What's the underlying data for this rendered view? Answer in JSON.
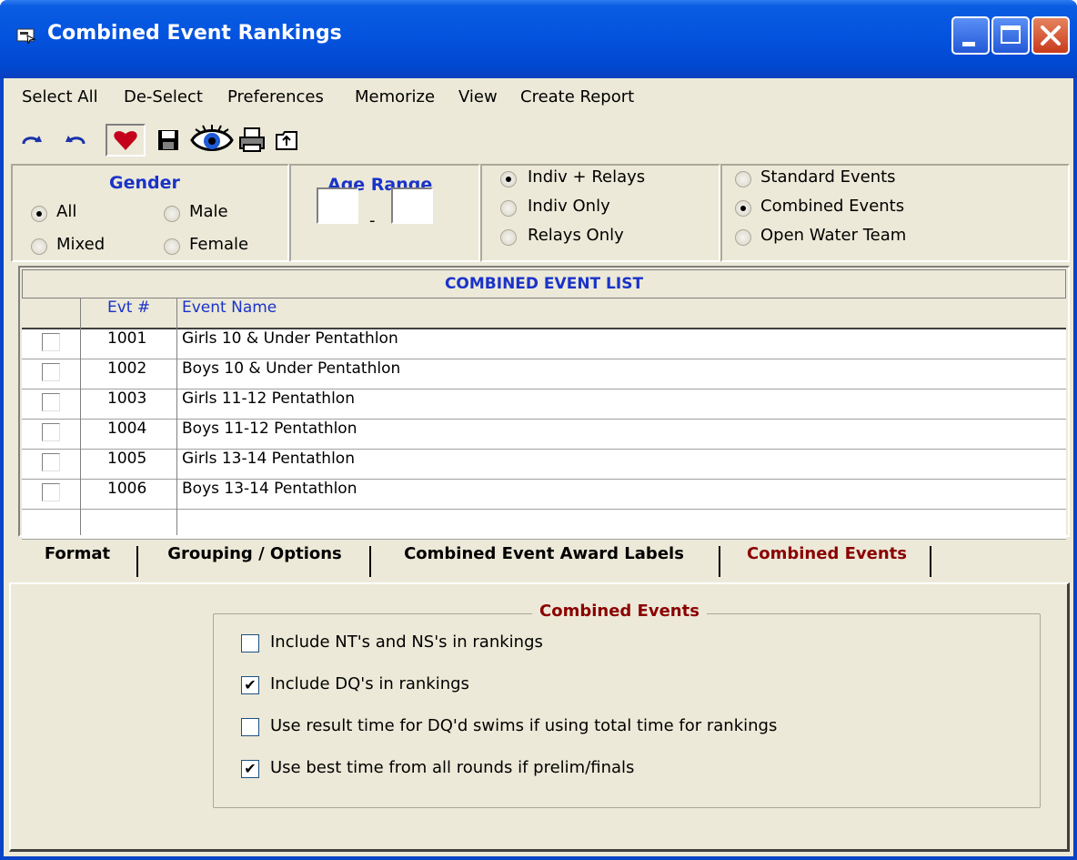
{
  "window": {
    "title": "Combined Event Rankings"
  },
  "menu": [
    "Select All",
    "De-Select",
    "Preferences",
    "Memorize",
    "View",
    "Create Report"
  ],
  "toolbar_icons": [
    "redo-icon",
    "undo-icon",
    "heart-icon",
    "save-icon",
    "eye-icon",
    "print-icon",
    "export-icon"
  ],
  "filters": {
    "gender": {
      "heading": "Gender",
      "options": [
        "All",
        "Male",
        "Mixed",
        "Female"
      ],
      "selected": "All"
    },
    "age_range": {
      "heading": "Age Range",
      "separator": "-",
      "from": "",
      "to": ""
    },
    "event_kind": {
      "options": [
        "Indiv + Relays",
        "Indiv Only",
        "Relays Only"
      ],
      "selected": "Indiv + Relays"
    },
    "event_type": {
      "options": [
        "Standard Events",
        "Combined Events",
        "Open Water Team"
      ],
      "selected": "Combined Events"
    }
  },
  "event_list": {
    "caption": "COMBINED EVENT LIST",
    "columns": [
      "",
      "Evt #",
      "Event Name"
    ],
    "rows": [
      {
        "num": "1001",
        "name": "Girls 10 & Under Pentathlon",
        "checked": false
      },
      {
        "num": "1002",
        "name": "Boys 10 & Under Pentathlon",
        "checked": false
      },
      {
        "num": "1003",
        "name": "Girls 11-12 Pentathlon",
        "checked": false
      },
      {
        "num": "1004",
        "name": "Boys 11-12 Pentathlon",
        "checked": false
      },
      {
        "num": "1005",
        "name": "Girls 13-14 Pentathlon",
        "checked": false
      },
      {
        "num": "1006",
        "name": "Boys 13-14 Pentathlon",
        "checked": false
      }
    ]
  },
  "tabs": [
    "Format",
    "Grouping / Options",
    "Combined Event Award Labels",
    "Combined Events"
  ],
  "active_tab": "Combined Events",
  "combined_events": {
    "legend": "Combined Events",
    "options": [
      {
        "label": "Include NT's and NS's in rankings",
        "checked": false
      },
      {
        "label": "Include DQ's in rankings",
        "checked": true
      },
      {
        "label": "Use result time for DQ'd swims if using total time for rankings",
        "checked": false
      },
      {
        "label": "Use best time from all rounds if prelim/finals",
        "checked": true
      }
    ]
  },
  "colors": {
    "title_bar": "#0555e0",
    "heading_blue": "#1a33c9",
    "heading_red": "#8b0000",
    "face": "#ece9d8"
  }
}
